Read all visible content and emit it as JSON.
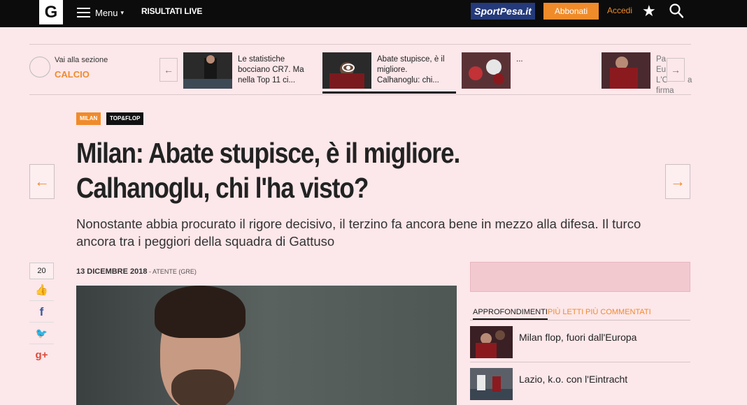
{
  "header": {
    "logo_text": "G",
    "menu_label": "Menu",
    "menu_caret": "▾",
    "live_label": "RISULTATI LIVE",
    "sponsor_label": "SportPesa.it",
    "subscribe_label": "Abbonati",
    "login_label": "Accedi",
    "star_glyph": "★"
  },
  "section_strip": {
    "goto_label": "Vai alla sezione",
    "section_name": "CALCIO",
    "prev_glyph": "←",
    "next_glyph": "→",
    "items": [
      {
        "text": "Le statistiche bocciano CR7. Ma nella Top 11 ci..."
      },
      {
        "text": "Abate stupisce, è il migliore. Calhanoglu: chi..."
      },
      {
        "text": "..."
      },
      {
        "text": "Pat... Eur... L'O... firma"
      }
    ],
    "right_item_lines": [
      "Pa",
      "Eu",
      "L'O",
      "firma"
    ],
    "right_item_lines2": [
      "",
      "",
      "a",
      ""
    ]
  },
  "article": {
    "tags": [
      "MILAN",
      "TOP&FLOP"
    ],
    "headline_line1": "Milan: Abate stupisce, è il migliore.",
    "headline_line2": "Calhanoglu, chi l'ha visto?",
    "subtitle": "Nonostante abbia procurato il rigore decisivo, il terzino fa ancora bene in mezzo alla difesa. Il turco ancora tra i peggiori della squadra di Gattuso",
    "date": "13 DICEMBRE 2018",
    "byline": " - ATENTE (GRE)",
    "prev_glyph": "←",
    "next_glyph": "→"
  },
  "share": {
    "count": "20",
    "like_glyph": "👍",
    "facebook_glyph": "f",
    "twitter_glyph": "🐦",
    "gplus_glyph": "g+"
  },
  "sidebar": {
    "tabs": [
      "APPROFONDIMENTI",
      "PIÙ LETTI",
      "PIÙ COMMENTATI"
    ],
    "items": [
      {
        "title": "Milan flop, fuori dall'Europa"
      },
      {
        "title": "Lazio, k.o. con l'Eintracht"
      }
    ]
  },
  "colors": {
    "accent": "#f08b2a",
    "background": "#fce7ea",
    "topbar": "#0c0c0c",
    "sponsor": "#243a7a"
  }
}
